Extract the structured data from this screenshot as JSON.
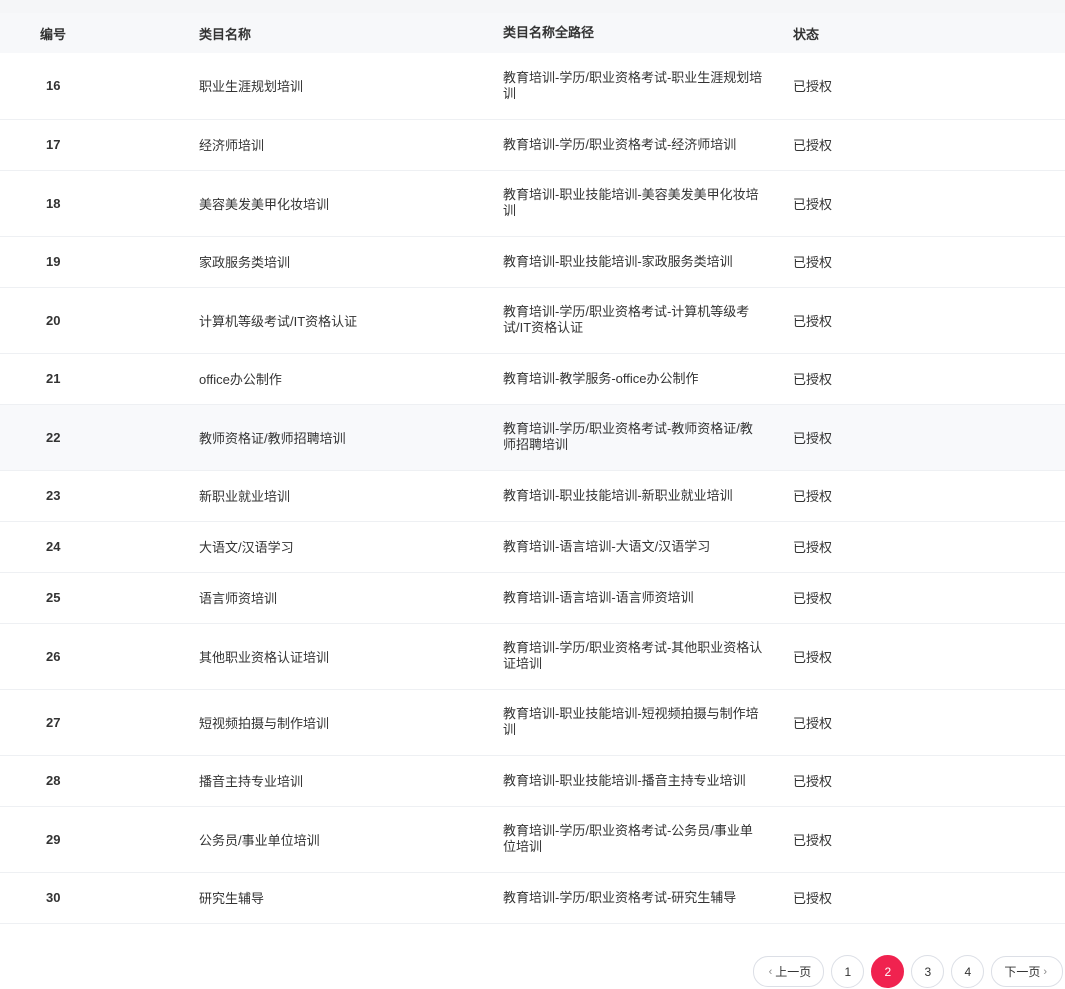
{
  "table": {
    "headers": [
      "编号",
      "类目名称",
      "类目名称全路径",
      "状态"
    ],
    "rows": [
      {
        "id": "16",
        "name": "职业生涯规划培训",
        "path": "教育培训-学历/职业资格考试-职业生涯规划培训",
        "status": "已授权"
      },
      {
        "id": "17",
        "name": "经济师培训",
        "path": "教育培训-学历/职业资格考试-经济师培训",
        "status": "已授权"
      },
      {
        "id": "18",
        "name": "美容美发美甲化妆培训",
        "path": "教育培训-职业技能培训-美容美发美甲化妆培训",
        "status": "已授权"
      },
      {
        "id": "19",
        "name": "家政服务类培训",
        "path": "教育培训-职业技能培训-家政服务类培训",
        "status": "已授权"
      },
      {
        "id": "20",
        "name": "计算机等级考试/IT资格认证",
        "path": "教育培训-学历/职业资格考试-计算机等级考试/IT资格认证",
        "status": "已授权"
      },
      {
        "id": "21",
        "name": "office办公制作",
        "path": "教育培训-教学服务-office办公制作",
        "status": "已授权"
      },
      {
        "id": "22",
        "name": "教师资格证/教师招聘培训",
        "path": "教育培训-学历/职业资格考试-教师资格证/教师招聘培训",
        "status": "已授权"
      },
      {
        "id": "23",
        "name": "新职业就业培训",
        "path": "教育培训-职业技能培训-新职业就业培训",
        "status": "已授权"
      },
      {
        "id": "24",
        "name": "大语文/汉语学习",
        "path": "教育培训-语言培训-大语文/汉语学习",
        "status": "已授权"
      },
      {
        "id": "25",
        "name": "语言师资培训",
        "path": "教育培训-语言培训-语言师资培训",
        "status": "已授权"
      },
      {
        "id": "26",
        "name": "其他职业资格认证培训",
        "path": "教育培训-学历/职业资格考试-其他职业资格认证培训",
        "status": "已授权"
      },
      {
        "id": "27",
        "name": "短视频拍摄与制作培训",
        "path": "教育培训-职业技能培训-短视频拍摄与制作培训",
        "status": "已授权"
      },
      {
        "id": "28",
        "name": "播音主持专业培训",
        "path": "教育培训-职业技能培训-播音主持专业培训",
        "status": "已授权"
      },
      {
        "id": "29",
        "name": "公务员/事业单位培训",
        "path": "教育培训-学历/职业资格考试-公务员/事业单位培训",
        "status": "已授权"
      },
      {
        "id": "30",
        "name": "研究生辅导",
        "path": "教育培训-学历/职业资格考试-研究生辅导",
        "status": "已授权"
      }
    ]
  },
  "pagination": {
    "prev_label": "上一页",
    "next_label": "下一页",
    "prev_icon": "chevron-left-icon",
    "next_icon": "chevron-right-icon",
    "pages": [
      "1",
      "2",
      "3",
      "4"
    ],
    "current_page": "2",
    "active_color": "#f0224f"
  }
}
